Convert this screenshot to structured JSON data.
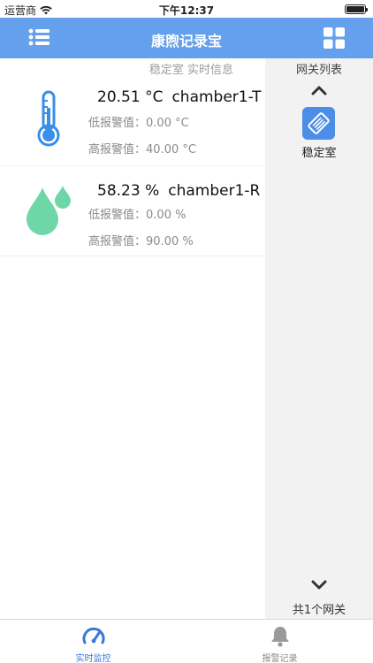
{
  "status_bar": {
    "carrier": "运营商",
    "time": "下午12:37",
    "wifi_icon": "wifi-icon",
    "battery_icon": "battery-icon"
  },
  "nav": {
    "title": "康煦记录宝",
    "menu_icon": "list-menu-icon",
    "grid_icon": "grid-icon",
    "color": "#64a0ec"
  },
  "main": {
    "caption": "稳定室 实时信息",
    "sensors": [
      {
        "icon": "thermometer-icon",
        "value": "20.51 °C",
        "name": "chamber1-T",
        "low_label": "低报警值",
        "low_value": "0.00 °C",
        "high_label": "高报警值",
        "high_value": "40.00 °C"
      },
      {
        "icon": "water-drop-icon",
        "value": "58.23 %",
        "name": "chamber1-R",
        "low_label": "低报警值",
        "low_value": "0.00 %",
        "high_label": "高报警值",
        "high_value": "90.00 %"
      }
    ]
  },
  "gateway_panel": {
    "title": "网关列表",
    "items": [
      {
        "label": "稳定室",
        "icon": "gateway-icon"
      }
    ],
    "count_text": "共1个网关"
  },
  "tabs": [
    {
      "label": "实时监控",
      "icon": "speedometer-icon",
      "active": true
    },
    {
      "label": "报警记录",
      "icon": "bell-icon",
      "active": false
    }
  ],
  "colors": {
    "accent": "#3a78d8",
    "thermometer": "#3a8ee6",
    "drop": "#6fd6a8"
  }
}
